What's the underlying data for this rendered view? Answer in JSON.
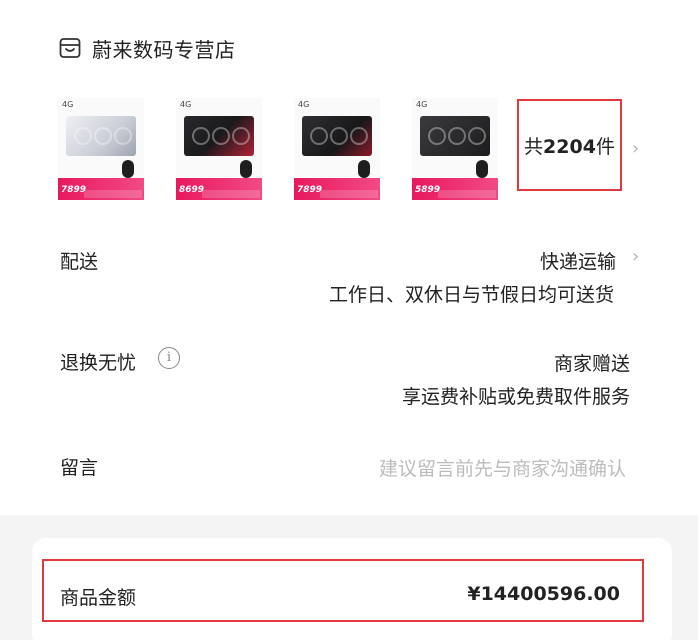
{
  "shop": {
    "icon": "shop-bag-icon",
    "name": "蔚来数码专营店"
  },
  "products": [
    {
      "price": "7899",
      "style": "light"
    },
    {
      "price": "8699",
      "style": "red"
    },
    {
      "price": "7899",
      "style": "dark"
    },
    {
      "price": "5899",
      "style": "black"
    }
  ],
  "product_count": {
    "prefix": "共",
    "number": "2204",
    "suffix": "件"
  },
  "delivery": {
    "label": "配送",
    "method": "快递运输",
    "note": "工作日、双休日与节假日均可送货"
  },
  "returns": {
    "label": "退换无忧",
    "info_icon": "info-circle-icon",
    "value": "商家赠送",
    "note": "享运费补贴或免费取件服务"
  },
  "message": {
    "label": "留言",
    "placeholder": "建议留言前先与商家沟通确认"
  },
  "total": {
    "label": "商品金额",
    "amount": "¥14400596.00"
  },
  "colors": {
    "highlight": "#e0393e",
    "price_tag": "#e8185e",
    "muted": "#bcbcbc"
  }
}
